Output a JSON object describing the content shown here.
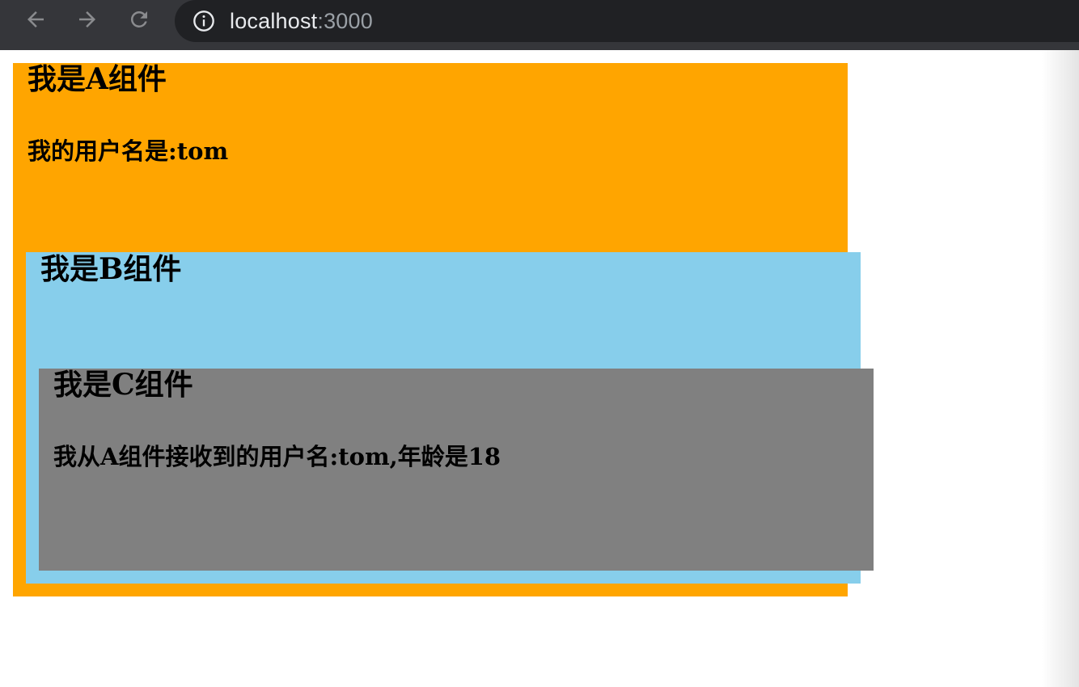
{
  "browser": {
    "url_host": "localhost",
    "url_port": ":3000"
  },
  "component_a": {
    "title": "我是A组件",
    "username_text": "我的用户名是:tom"
  },
  "component_b": {
    "title": "我是B组件"
  },
  "component_c": {
    "title": "我是C组件",
    "message": "我从A组件接收到的用户名:tom,年龄是18"
  },
  "colors": {
    "component_a_bg": "#ffa500",
    "component_b_bg": "#87ceeb",
    "component_c_bg": "#808080"
  }
}
